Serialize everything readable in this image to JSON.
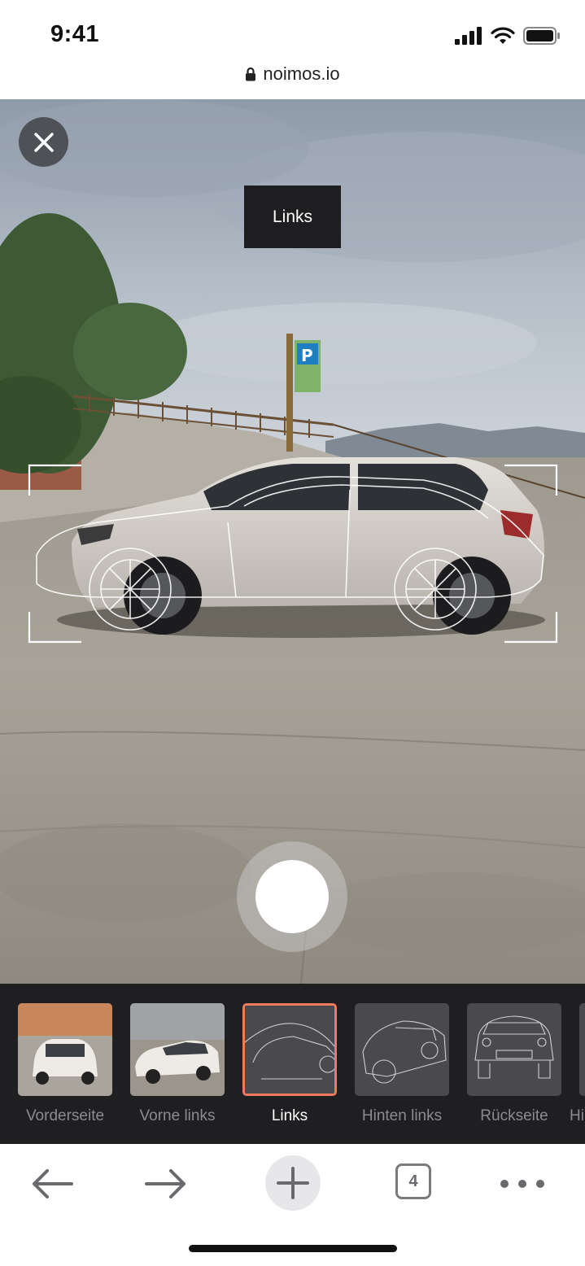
{
  "status": {
    "time": "9:41",
    "icons": [
      "signal-icon",
      "wifi-icon",
      "battery-icon"
    ]
  },
  "browser": {
    "url": "noimos.io",
    "tab_count": "4",
    "toolbar_icons": [
      "back-arrow-icon",
      "forward-arrow-icon",
      "plus-icon",
      "tabs-icon",
      "more-icon"
    ]
  },
  "camera": {
    "current_view": "Links"
  },
  "thumbnails": [
    {
      "label": "Vorderseite",
      "kind": "photo",
      "state": "captured"
    },
    {
      "label": "Vorne links",
      "kind": "photo",
      "state": "captured"
    },
    {
      "label": "Links",
      "kind": "outline",
      "state": "active"
    },
    {
      "label": "Hinten links",
      "kind": "outline",
      "state": "pending"
    },
    {
      "label": "Rückseite",
      "kind": "outline",
      "state": "pending"
    },
    {
      "label": "Hi",
      "kind": "outline",
      "state": "pending"
    }
  ],
  "colors": {
    "accent": "#f07a5b",
    "strip_bg": "#1f1f22",
    "label_bg": "#1e1e20"
  }
}
